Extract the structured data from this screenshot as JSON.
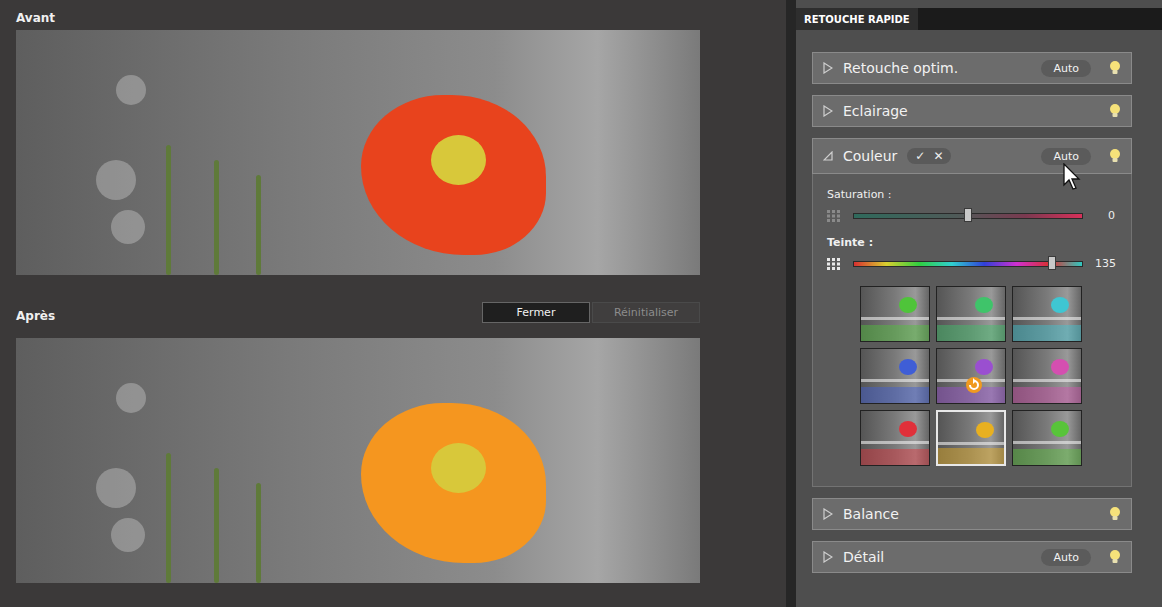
{
  "photos": [
    {
      "label": "Avant",
      "color": "#e8431d"
    },
    {
      "label": "Après",
      "color": "#f5961f"
    }
  ],
  "buttons": [
    {
      "label": "Fermer",
      "disabled": false
    },
    {
      "label": "Réinitialiser",
      "disabled": true
    }
  ],
  "panel": {
    "title": "RETOUCHE RAPIDE"
  },
  "sections": [
    {
      "label": "Retouche optim.",
      "expanded": false,
      "auto": "Auto"
    },
    {
      "label": "Eclairage",
      "expanded": false
    },
    {
      "label": "Couleur",
      "expanded": true,
      "auto": "Auto",
      "confirm": "✓",
      "cancel": "✕",
      "pointer": true
    },
    {
      "label": "Balance",
      "expanded": false
    },
    {
      "label": "Détail",
      "expanded": false,
      "auto": "Auto"
    }
  ],
  "color_panel": {
    "sliders": [
      {
        "label": "Saturation :",
        "kind": "saturation",
        "level": 0.5,
        "reading": "0"
      },
      {
        "label": "Teinte :",
        "kind": "hue",
        "level": 0.87,
        "reading": "135"
      }
    ],
    "presets": [
      {
        "color": "#4fc43a",
        "selected": false,
        "hovered": false
      },
      {
        "color": "#3fc46a",
        "selected": false,
        "hovered": false
      },
      {
        "color": "#3fc6d2",
        "selected": false,
        "hovered": false
      },
      {
        "color": "#3f5ed6",
        "selected": false,
        "hovered": false
      },
      {
        "color": "#9a4fd0",
        "selected": false,
        "hovered": true
      },
      {
        "color": "#d44fb0",
        "selected": false,
        "hovered": false
      },
      {
        "color": "#e0303a",
        "selected": false,
        "hovered": false
      },
      {
        "color": "#e8b020",
        "selected": true,
        "hovered": false
      },
      {
        "color": "#58c43a",
        "selected": false,
        "hovered": false
      }
    ]
  }
}
